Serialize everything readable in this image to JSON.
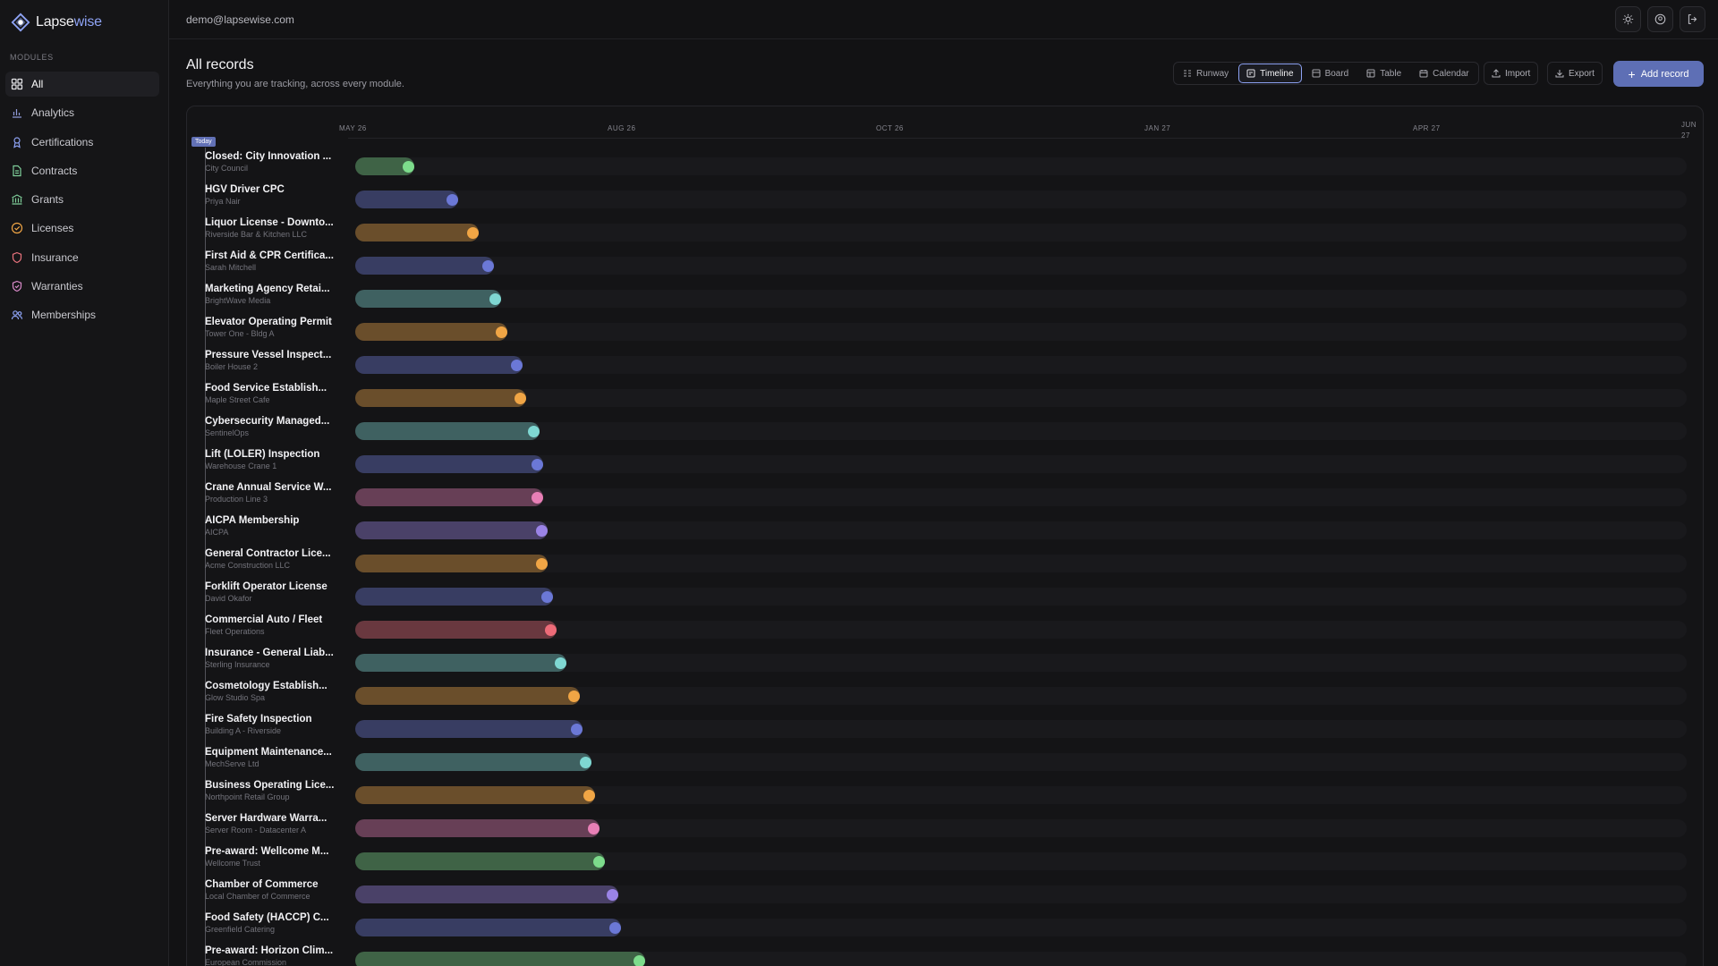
{
  "app": {
    "name_part1": "Lapse",
    "name_part2": "wise"
  },
  "sidebar": {
    "section_label": "MODULES",
    "items": [
      {
        "label": "All",
        "icon": "grid-icon"
      },
      {
        "label": "Analytics",
        "icon": "chart-icon"
      },
      {
        "label": "Certifications",
        "icon": "award-icon"
      },
      {
        "label": "Contracts",
        "icon": "document-icon"
      },
      {
        "label": "Grants",
        "icon": "bank-icon"
      },
      {
        "label": "Licenses",
        "icon": "badge-check-icon"
      },
      {
        "label": "Insurance",
        "icon": "shield-icon"
      },
      {
        "label": "Warranties",
        "icon": "shield-check-icon"
      },
      {
        "label": "Memberships",
        "icon": "users-icon"
      }
    ]
  },
  "topbar": {
    "email": "demo@lapsewise.com"
  },
  "header": {
    "title": "All records",
    "subtitle": "Everything you are tracking, across every module."
  },
  "views": {
    "runway": "Runway",
    "timeline": "Timeline",
    "board": "Board",
    "table": "Table",
    "calendar": "Calendar"
  },
  "actions": {
    "import": "Import",
    "export": "Export",
    "add": "Add record"
  },
  "timeline": {
    "today_label": "Today",
    "ticks": [
      "MAY 26",
      "AUG 26",
      "OCT 26",
      "JAN 27",
      "APR 27",
      "JUN 27"
    ],
    "rows": [
      {
        "name": "Closed: City Innovation ...",
        "sub": "City Council",
        "progress": 0.035,
        "color": "#7ddc8c"
      },
      {
        "name": "HGV Driver CPC",
        "sub": "Priya Nair",
        "progress": 0.068,
        "color": "#6b78d6"
      },
      {
        "name": "Liquor License - Downto...",
        "sub": "Riverside Bar & Kitchen LLC",
        "progress": 0.083,
        "color": "#f0a545"
      },
      {
        "name": "First Aid & CPR Certifica...",
        "sub": "Sarah Mitchell",
        "progress": 0.095,
        "color": "#6b78d6"
      },
      {
        "name": "Marketing Agency Retai...",
        "sub": "BrightWave Media",
        "progress": 0.1,
        "color": "#7fd7d2"
      },
      {
        "name": "Elevator Operating Permit",
        "sub": "Tower One - Bldg A",
        "progress": 0.105,
        "color": "#f0a545"
      },
      {
        "name": "Pressure Vessel Inspect...",
        "sub": "Boiler House 2",
        "progress": 0.116,
        "color": "#6b78d6"
      },
      {
        "name": "Food Service Establish...",
        "sub": "Maple Street Cafe",
        "progress": 0.119,
        "color": "#f0a545"
      },
      {
        "name": "Cybersecurity Managed...",
        "sub": "SentinelOps",
        "progress": 0.129,
        "color": "#7fd7d2"
      },
      {
        "name": "Lift (LOLER) Inspection",
        "sub": "Warehouse Crane 1",
        "progress": 0.132,
        "color": "#6b78d6"
      },
      {
        "name": "Crane Annual Service W...",
        "sub": "Production Line 3",
        "progress": 0.132,
        "color": "#e87fb6"
      },
      {
        "name": "AICPA Membership",
        "sub": "AICPA",
        "progress": 0.135,
        "color": "#9a83e6"
      },
      {
        "name": "General Contractor Lice...",
        "sub": "Acme Construction LLC",
        "progress": 0.135,
        "color": "#f0a545"
      },
      {
        "name": "Forklift Operator License",
        "sub": "David Okafor",
        "progress": 0.139,
        "color": "#6b78d6"
      },
      {
        "name": "Commercial Auto / Fleet",
        "sub": "Fleet Operations",
        "progress": 0.142,
        "color": "#ec6b78"
      },
      {
        "name": "Insurance - General Liab...",
        "sub": "Sterling Insurance",
        "progress": 0.149,
        "color": "#7fd7d2"
      },
      {
        "name": "Cosmetology Establish...",
        "sub": "Glow Studio Spa",
        "progress": 0.159,
        "color": "#f0a545"
      },
      {
        "name": "Fire Safety Inspection",
        "sub": "Building A - Riverside",
        "progress": 0.161,
        "color": "#6b78d6"
      },
      {
        "name": "Equipment Maintenance...",
        "sub": "MechServe Ltd",
        "progress": 0.168,
        "color": "#7fd7d2"
      },
      {
        "name": "Business Operating Lice...",
        "sub": "Northpoint Retail Group",
        "progress": 0.171,
        "color": "#f0a545"
      },
      {
        "name": "Server Hardware Warra...",
        "sub": "Server Room - Datacenter A",
        "progress": 0.174,
        "color": "#e87fb6"
      },
      {
        "name": "Pre-award: Wellcome M...",
        "sub": "Wellcome Trust",
        "progress": 0.178,
        "color": "#7ddc8c"
      },
      {
        "name": "Chamber of Commerce",
        "sub": "Local Chamber of Commerce",
        "progress": 0.188,
        "color": "#9a83e6"
      },
      {
        "name": "Food Safety (HACCP) C...",
        "sub": "Greenfield Catering",
        "progress": 0.19,
        "color": "#6b78d6"
      },
      {
        "name": "Pre-award: Horizon Clim...",
        "sub": "European Commission",
        "progress": 0.208,
        "color": "#7ddc8c"
      }
    ]
  }
}
